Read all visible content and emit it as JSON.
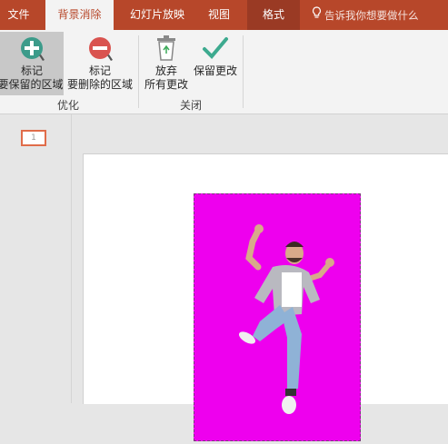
{
  "tabs": {
    "file": "文件",
    "background_removal": "背景消除",
    "slideshow": "幻灯片放映",
    "view": "视图",
    "format": "格式"
  },
  "tell_me": "告诉我你想要做什么",
  "ribbon": {
    "mark_keep_line1": "标记",
    "mark_keep_line2": "要保留的区域",
    "mark_remove_line1": "标记",
    "mark_remove_line2": "要删除的区域",
    "refine_group": "优化",
    "discard_line1": "放弃",
    "discard_line2": "所有更改",
    "keep_changes": "保留更改",
    "close_group": "关闭"
  },
  "thumbnail_number": "1",
  "colors": {
    "brand": "#b7472a",
    "removal_overlay": "#ee00ee",
    "add_icon": "#3c9b8a",
    "remove_icon": "#d9534f",
    "check_icon": "#3daa8f"
  }
}
